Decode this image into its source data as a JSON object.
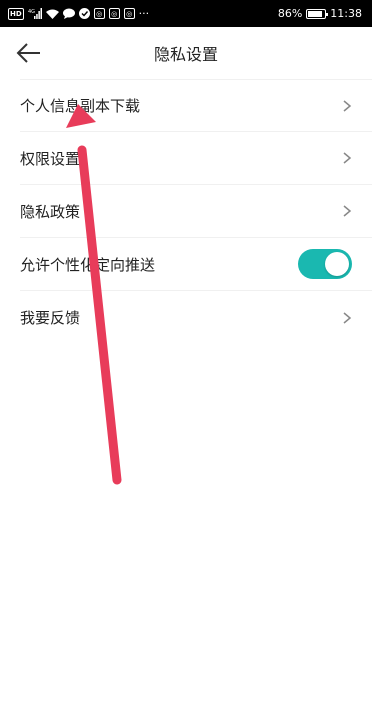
{
  "status_bar": {
    "left_icons": [
      "hd-icon",
      "signal-icon",
      "wifi-icon",
      "chat-icon",
      "heart-icon",
      "app-icon",
      "app-icon",
      "app-icon",
      "more-icon"
    ],
    "battery_pct": "86%",
    "battery_level": 0.86,
    "time": "11:38"
  },
  "header": {
    "title": "隐私设置",
    "back_icon": "back-arrow-icon"
  },
  "settings": {
    "items": [
      {
        "label": "个人信息副本下载"
      },
      {
        "label": "权限设置"
      },
      {
        "label": "隐私政策"
      },
      {
        "label": "允许个性化定向推送",
        "toggle_on": true
      },
      {
        "label": "我要反馈"
      }
    ]
  },
  "colors": {
    "toggle_on": "#1ab8b0",
    "annotation_arrow": "#e83c5a"
  }
}
